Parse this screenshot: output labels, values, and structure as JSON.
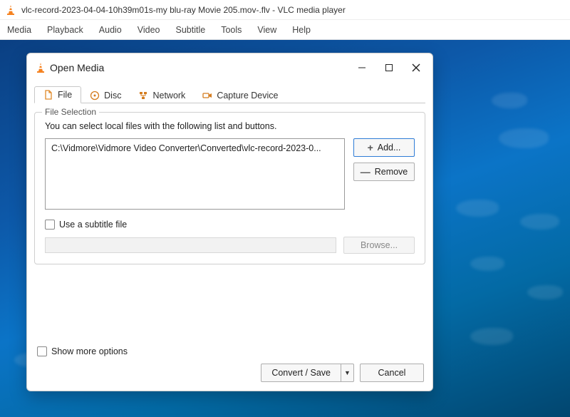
{
  "app": {
    "title": "vlc-record-2023-04-04-10h39m01s-my blu-ray Movie 205.mov-.flv - VLC media player"
  },
  "menubar": [
    "Media",
    "Playback",
    "Audio",
    "Video",
    "Subtitle",
    "Tools",
    "View",
    "Help"
  ],
  "dialog": {
    "title": "Open Media",
    "tabs": {
      "file": {
        "label": "File"
      },
      "disc": {
        "label": "Disc"
      },
      "network": {
        "label": "Network"
      },
      "capture": {
        "label": "Capture Device"
      }
    },
    "file_selection": {
      "legend": "File Selection",
      "help": "You can select local files with the following list and buttons.",
      "selected_path": "C:\\Vidmore\\Vidmore Video Converter\\Converted\\vlc-record-2023-0...",
      "add_label": "Add...",
      "remove_label": "Remove"
    },
    "subtitle": {
      "checkbox_label": "Use a subtitle file",
      "browse_label": "Browse..."
    },
    "show_more_label": "Show more options",
    "footer": {
      "convert_label": "Convert / Save",
      "cancel_label": "Cancel"
    }
  }
}
